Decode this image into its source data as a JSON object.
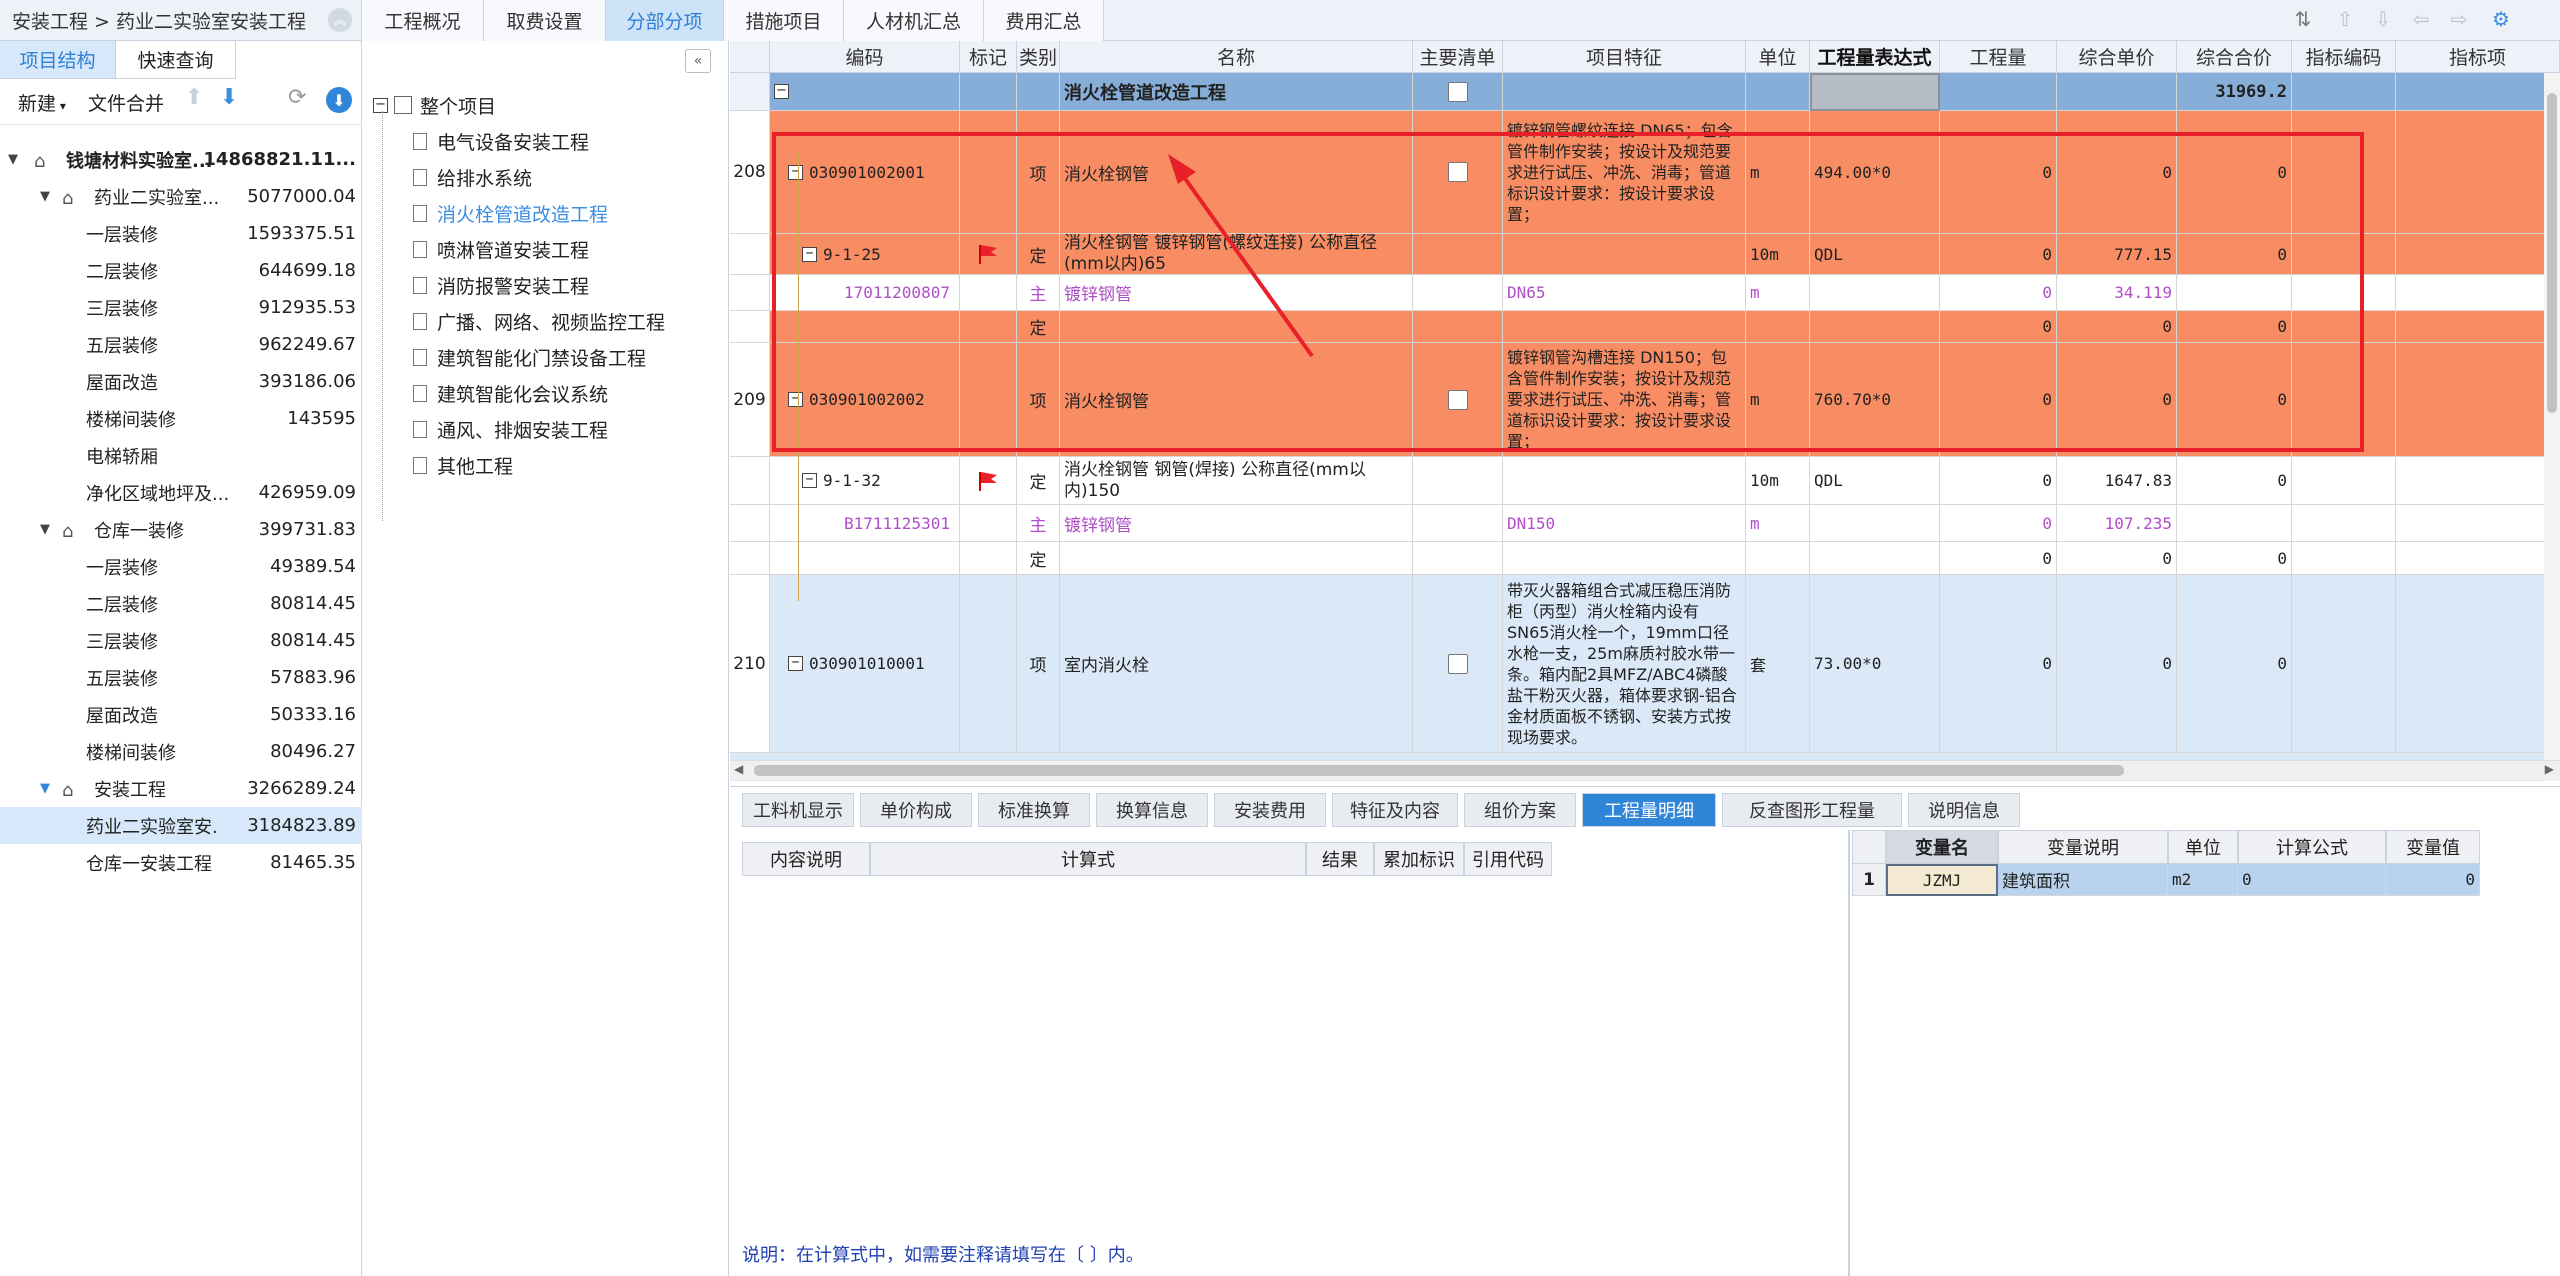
{
  "breadcrumb": "安装工程 > 药业二实验室安装工程",
  "main_tabs": [
    "工程概况",
    "取费设置",
    "分部分项",
    "措施项目",
    "人材机汇总",
    "费用汇总"
  ],
  "left_tabs": [
    "项目结构",
    "快速查询"
  ],
  "left_toolbar": {
    "new_label": "新建",
    "merge_label": "文件合并"
  },
  "tree": [
    {
      "name": "钱塘材料实验室...",
      "value": "14868821.11..."
    },
    {
      "name": "药业二实验室...",
      "value": "5077000.04"
    },
    {
      "name": "一层装修",
      "value": "1593375.51"
    },
    {
      "name": "二层装修",
      "value": "644699.18"
    },
    {
      "name": "三层装修",
      "value": "912935.53"
    },
    {
      "name": "五层装修",
      "value": "962249.67"
    },
    {
      "name": "屋面改造",
      "value": "393186.06"
    },
    {
      "name": "楼梯间装修",
      "value": "143595"
    },
    {
      "name": "电梯轿厢",
      "value": ""
    },
    {
      "name": "净化区域地坪及...",
      "value": "426959.09"
    },
    {
      "name": "仓库一装修",
      "value": "399731.83"
    },
    {
      "name": "一层装修",
      "value": "49389.54"
    },
    {
      "name": "二层装修",
      "value": "80814.45"
    },
    {
      "name": "三层装修",
      "value": "80814.45"
    },
    {
      "name": "五层装修",
      "value": "57883.96"
    },
    {
      "name": "屋面改造",
      "value": "50333.16"
    },
    {
      "name": "楼梯间装修",
      "value": "80496.27"
    },
    {
      "name": "安装工程",
      "value": "3266289.24"
    },
    {
      "name": "药业二实验室安.",
      "value": "3184823.89"
    },
    {
      "name": "仓库一安装工程",
      "value": "81465.35"
    }
  ],
  "mid_tree": {
    "root": "整个项目",
    "items": [
      "电气设备安装工程",
      "给排水系统",
      "消火栓管道改造工程",
      "喷淋管道安装工程",
      "消防报警安装工程",
      "广播、网络、视频监控工程",
      "建筑智能化门禁设备工程",
      "建筑智能化会议系统",
      "通风、排烟安装工程",
      "其他工程"
    ]
  },
  "grid_headers": [
    "编码",
    "标记",
    "类别",
    "名称",
    "主要清单",
    "项目特征",
    "单位",
    "工程量表达式",
    "工程量",
    "综合单价",
    "综合合价",
    "指标编码",
    "指标项"
  ],
  "section_row": {
    "name": "消火栓管道改造工程",
    "total": "31969.2"
  },
  "rows": [
    {
      "no": "208",
      "code": "030901002001",
      "type": "项",
      "name": "消火栓钢管",
      "feature": "镀锌钢管螺纹连接 DN65；包含管件制作安装；按设计及规范要求进行试压、冲洗、消毒；管道标识设计要求：按设计要求设置；",
      "unit": "m",
      "expr": "494.00*0",
      "qty": "0",
      "price": "0",
      "total": "0"
    },
    {
      "no": "",
      "code": "9-1-25",
      "type": "定",
      "name": "消火栓钢管 镀锌钢管(螺纹连接) 公称直径(mm以内)65",
      "feature": "",
      "unit": "10m",
      "expr": "QDL",
      "qty": "0",
      "price": "777.15",
      "total": "0"
    },
    {
      "no": "",
      "code": "17011200807",
      "type": "主",
      "name": "镀锌钢管",
      "feature": "DN65",
      "unit": "m",
      "expr": "",
      "qty": "0",
      "price": "34.119",
      "total": ""
    },
    {
      "no": "",
      "code": "",
      "type": "定",
      "name": "",
      "feature": "",
      "unit": "",
      "expr": "",
      "qty": "0",
      "price": "0",
      "total": "0"
    },
    {
      "no": "209",
      "code": "030901002002",
      "type": "项",
      "name": "消火栓钢管",
      "feature": "镀锌钢管沟槽连接 DN150；包含管件制作安装；按设计及规范要求进行试压、冲洗、消毒；管道标识设计要求：按设计要求设置；",
      "unit": "m",
      "expr": "760.70*0",
      "qty": "0",
      "price": "0",
      "total": "0"
    },
    {
      "no": "",
      "code": "9-1-32",
      "type": "定",
      "name": "消火栓钢管 钢管(焊接) 公称直径(mm以内)150",
      "feature": "",
      "unit": "10m",
      "expr": "QDL",
      "qty": "0",
      "price": "1647.83",
      "total": "0"
    },
    {
      "no": "",
      "code": "B1711125301",
      "type": "主",
      "name": "镀锌钢管",
      "feature": "DN150",
      "unit": "m",
      "expr": "",
      "qty": "0",
      "price": "107.235",
      "total": ""
    },
    {
      "no": "",
      "code": "",
      "type": "定",
      "name": "",
      "feature": "",
      "unit": "",
      "expr": "",
      "qty": "0",
      "price": "0",
      "total": "0"
    },
    {
      "no": "210",
      "code": "030901010001",
      "type": "项",
      "name": "室内消火栓",
      "feature": "带灭火器箱组合式减压稳压消防柜（丙型）消火栓箱内设有SN65消火栓一个，19mm口径水枪一支，25m麻质衬胶水带一条。箱内配2具MFZ/ABC4磷酸盐干粉灭火器，箱体要求钢-铝合金材质面板不锈钢、安装方式按现场要求。",
      "unit": "套",
      "expr": "73.00*0",
      "qty": "0",
      "price": "0",
      "total": "0"
    }
  ],
  "bottom_tabs": [
    "工料机显示",
    "单价构成",
    "标准换算",
    "换算信息",
    "安装费用",
    "特征及内容",
    "组价方案",
    "工程量明细",
    "反查图形工程量",
    "说明信息"
  ],
  "calc_headers": [
    "内容说明",
    "计算式",
    "结果",
    "累加标识",
    "引用代码"
  ],
  "var_headers": [
    "变量名",
    "变量说明",
    "单位",
    "计算公式",
    "变量值"
  ],
  "var_rows": [
    {
      "idx": "1",
      "name": "JZMJ",
      "desc": "建筑面积",
      "unit": "m2",
      "formula": "0",
      "value": "0"
    }
  ],
  "note": "说明：在计算式中，如需要注释请填写在〔 〕内。",
  "colors": {
    "accent": "#2f86d8",
    "highlight_row": "#f88c62",
    "header_row": "#87aed8",
    "annotation": "#e8202a"
  }
}
